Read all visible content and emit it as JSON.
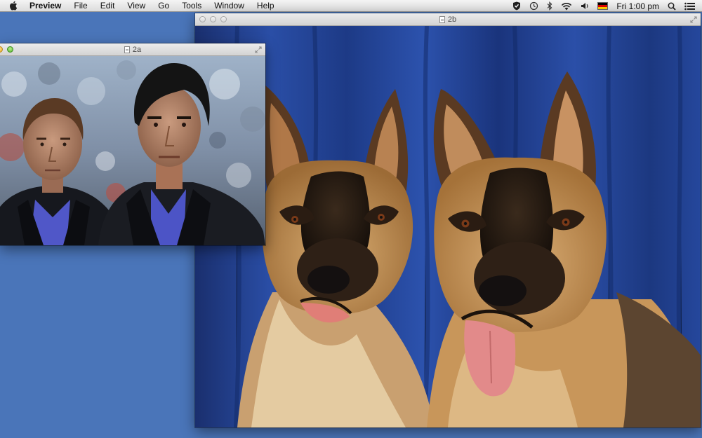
{
  "menubar": {
    "apple_icon": "apple-icon",
    "items": [
      "Preview",
      "File",
      "Edit",
      "View",
      "Go",
      "Tools",
      "Window",
      "Help"
    ],
    "clock": "Fri 1:00 pm",
    "status_icons": [
      "shield-icon",
      "time-machine-icon",
      "bluetooth-icon",
      "wifi-icon",
      "volume-icon",
      "german-flag-icon",
      "spotlight-search-icon",
      "notification-center-icon"
    ]
  },
  "windows": {
    "back": {
      "title": "2b",
      "image": "two-german-shepherd-dogs-photo"
    },
    "front": {
      "title": "2a",
      "image": "two-men-in-dark-suits-photo"
    }
  },
  "colors": {
    "desktop": "#4a75b9",
    "curtain": "#1f3f8c",
    "dog_tan": "#c8965a",
    "dog_dark": "#2a1e14"
  }
}
